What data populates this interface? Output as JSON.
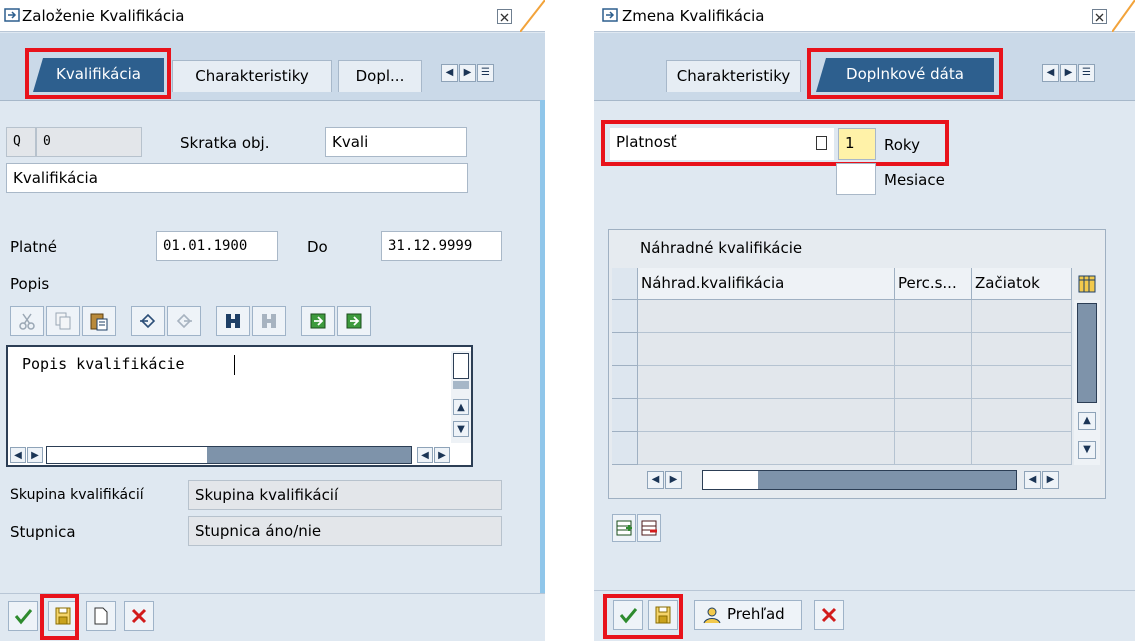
{
  "left": {
    "title": "Založenie Kvalifikácia",
    "tabs": [
      "Kvalifikácia",
      "Charakteristiky",
      "Dopl..."
    ],
    "object_type": "Q",
    "object_id": "0",
    "abbr_label": "Skratka obj.",
    "abbr_value": "Kvali",
    "name_value": "Kvalifikácia",
    "valid_label": "Platné",
    "valid_from": "01.01.1900",
    "to_label": "Do",
    "valid_to": "31.12.9999",
    "desc_label": "Popis",
    "editor_text": "Popis kvalifikácie",
    "group_label": "Skupina kvalifikácií",
    "group_value": "Skupina kvalifikácií",
    "scale_label": "Stupnica",
    "scale_value": "Stupnica áno/nie"
  },
  "right": {
    "title": "Zmena Kvalifikácia",
    "tabs": [
      "Charakteristiky",
      "Doplnkové dáta"
    ],
    "validity_label": "Platnosť",
    "years_value": "1",
    "years_label": "Roky",
    "months_value": "",
    "months_label": "Mesiace",
    "table_title": "Náhradné kvalifikácie",
    "columns": [
      "Náhrad.kvalifikácia",
      "Perc.s...",
      "Začiatok"
    ],
    "overview_label": "Prehľad"
  },
  "colors": {
    "highlight": "#e8121b",
    "active_tab": "#2d5f8e",
    "panel": "#dfe8f1"
  }
}
